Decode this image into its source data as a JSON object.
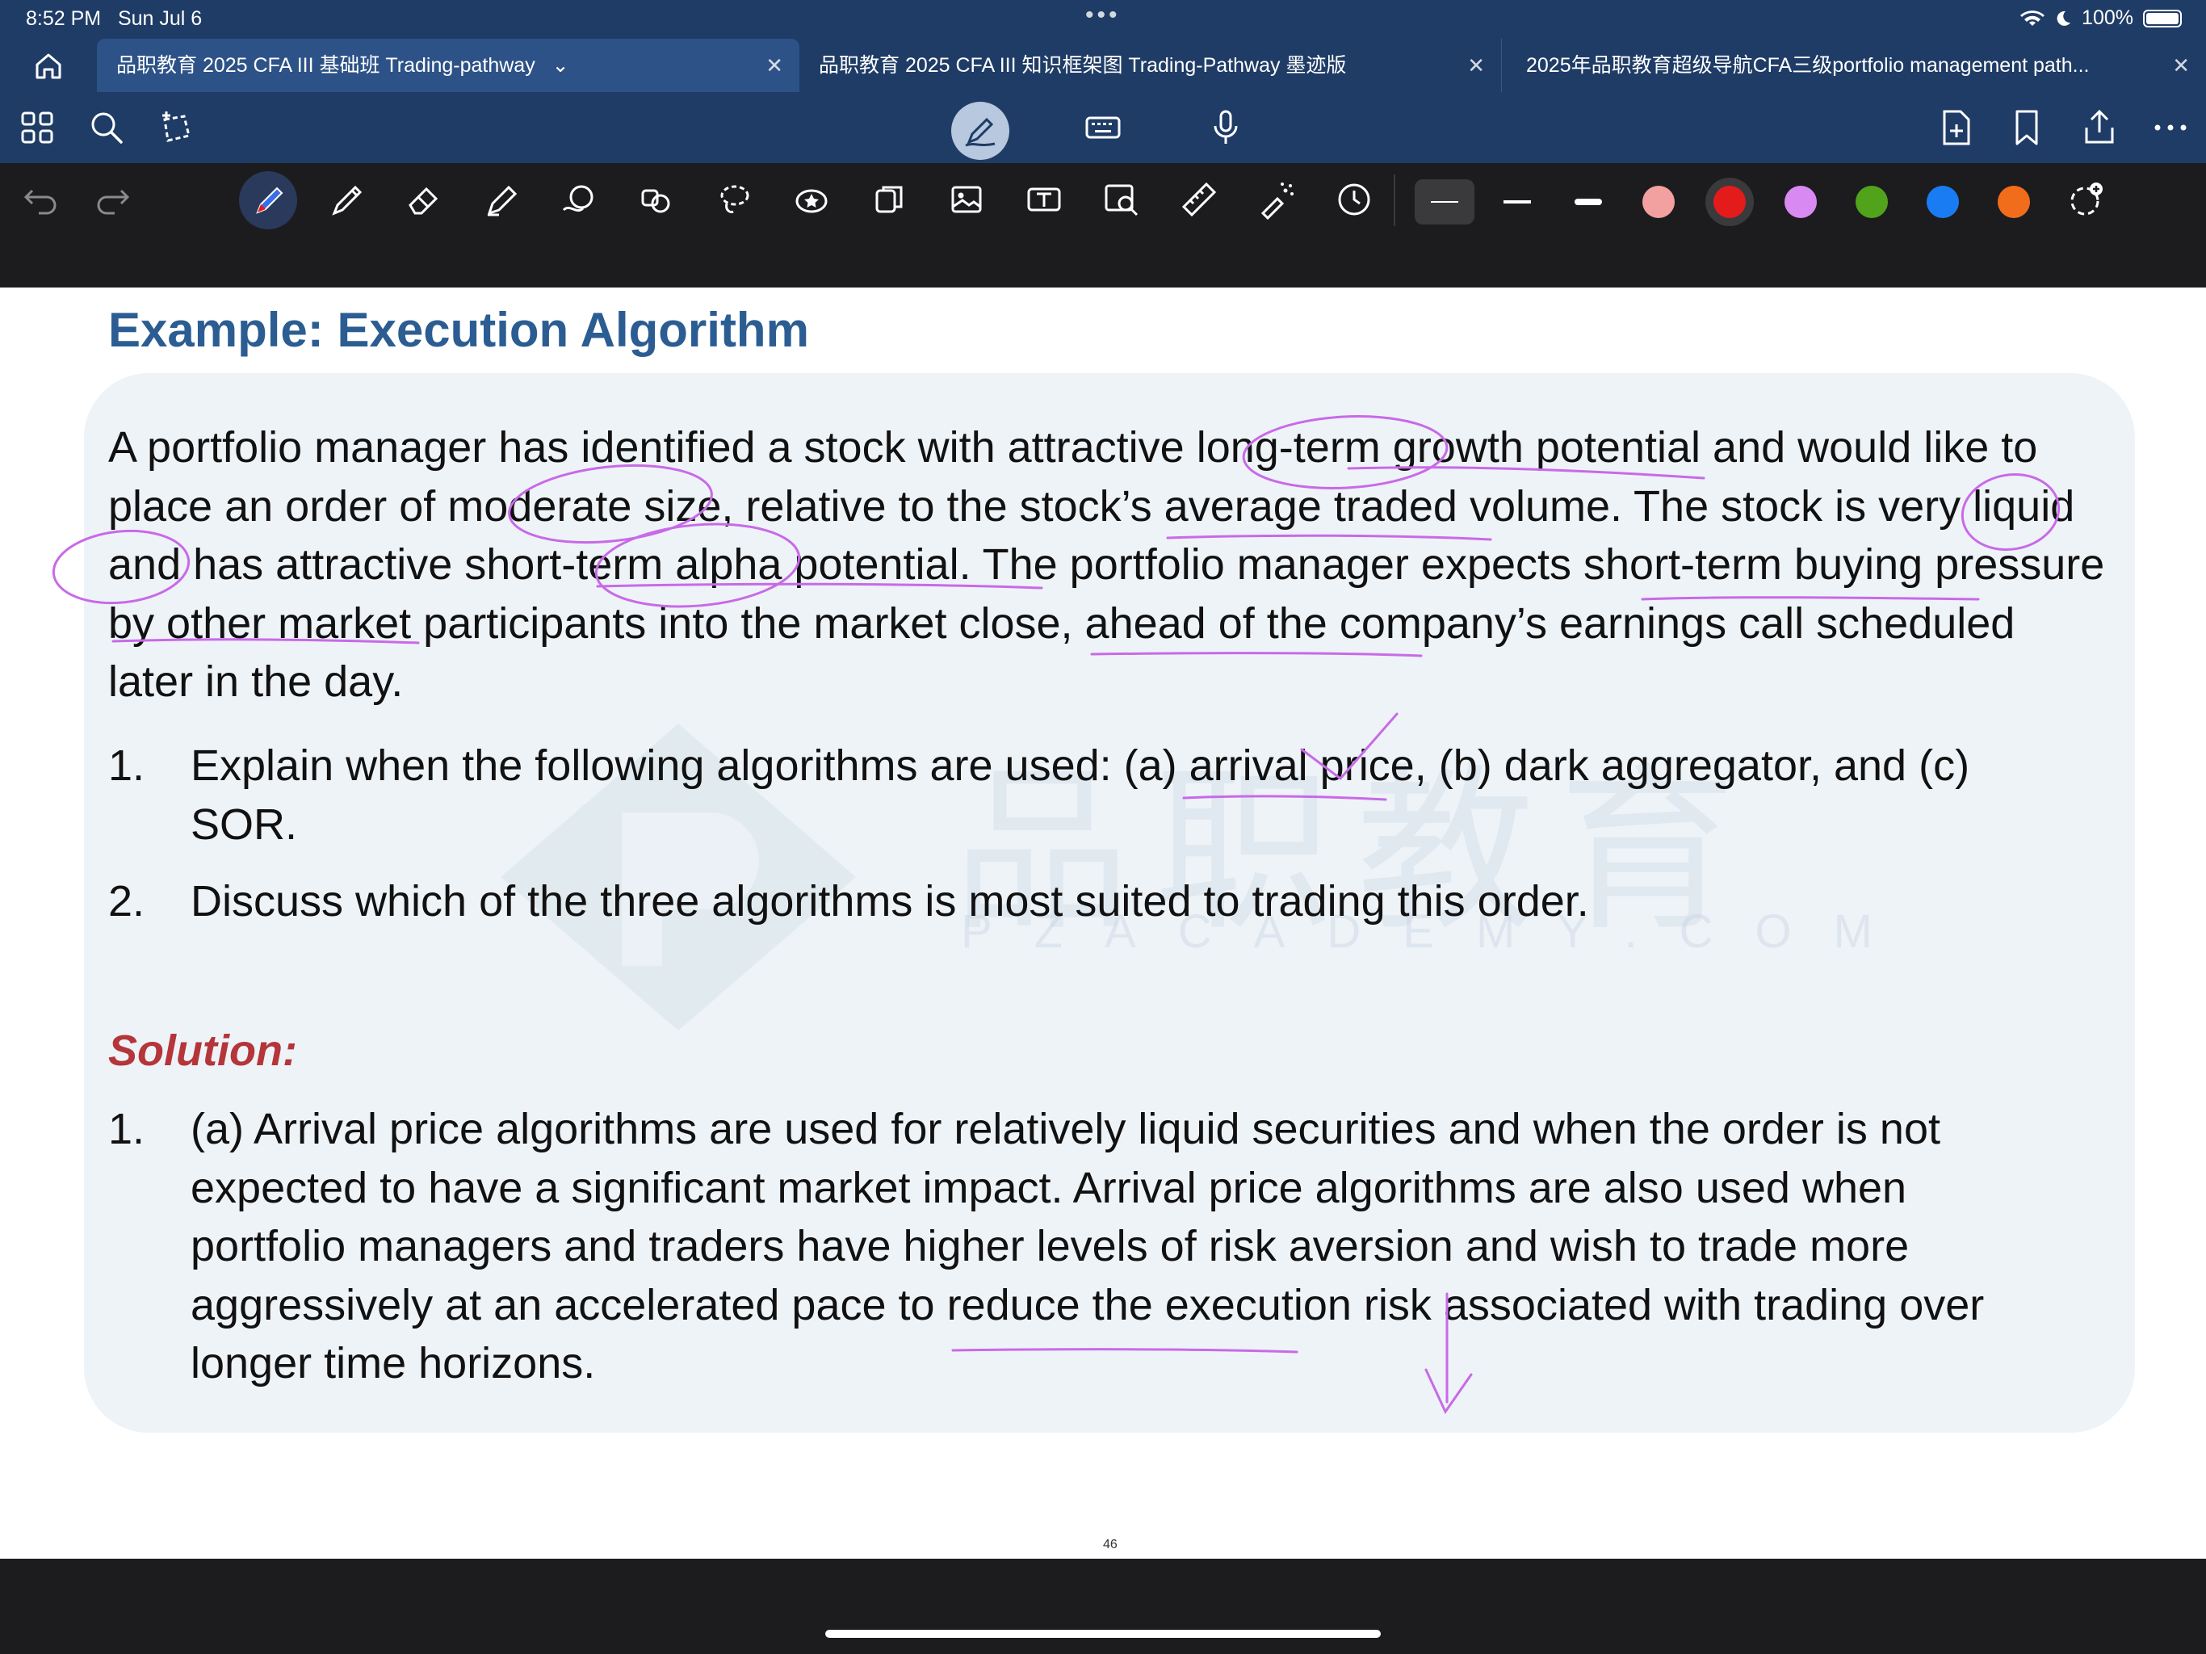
{
  "status_bar": {
    "time": "8:52 PM",
    "date": "Sun Jul 6",
    "battery": "100%"
  },
  "tabs": [
    {
      "label": "品职教育 2025 CFA III 基础班 Trading-pathway",
      "active": true
    },
    {
      "label": "品职教育 2025 CFA III 知识框架图 Trading-Pathway 墨迹版",
      "active": false
    },
    {
      "label": "2025年品职教育超级导航CFA三级portfolio management path...",
      "active": false
    }
  ],
  "toolbar": {
    "left_icons": [
      "grid-icon",
      "search-icon",
      "lasso-select-icon"
    ],
    "center_icons": [
      "pen-mode-icon",
      "keyboard-icon",
      "microphone-icon"
    ],
    "right_icons": [
      "add-page-icon",
      "bookmark-icon",
      "share-icon",
      "more-icon"
    ]
  },
  "drawing_tools": [
    "pen",
    "pencil",
    "eraser",
    "highlighter",
    "shape",
    "elements",
    "lasso",
    "sticker",
    "copy",
    "image",
    "text",
    "image-search",
    "ruler",
    "laser",
    "timer"
  ],
  "pen_colors": [
    "#f2a0a0",
    "#e31b1b",
    "#d98af2",
    "#52a31c",
    "#1a7cf2",
    "#f26d1b"
  ],
  "slide": {
    "title": "Example: Execution Algorithm",
    "paragraph": "A portfolio manager has identified a stock with attractive long-term growth potential and would like to place an order of moderate size, relative to the stock’s average traded volume. The stock is very liquid and has attractive short-term alpha potential. The portfolio manager expects short-term buying pressure by other market participants into the market close, ahead of the company’s earnings call scheduled later in the day.",
    "questions": [
      {
        "num": "1.",
        "text": "Explain when the following algorithms are used: (a) arrival price, (b) dark aggregator, and (c) SOR."
      },
      {
        "num": "2.",
        "text": "Discuss which of the three algorithms is most suited to trading this order."
      }
    ],
    "solution_label": "Solution:",
    "solutions": [
      {
        "num": "1.",
        "text": "(a) Arrival price algorithms are used for relatively liquid securities and when the order is not expected to have a significant market impact. Arrival price algorithms are also used when portfolio managers and traders have higher levels of risk aversion and wish to trade more aggressively at an accelerated pace to reduce the execution risk associated with trading over longer time horizons."
      }
    ],
    "watermark": "品职教育",
    "watermark_sub": "PZACADEMY.COM",
    "page_number": "46"
  }
}
